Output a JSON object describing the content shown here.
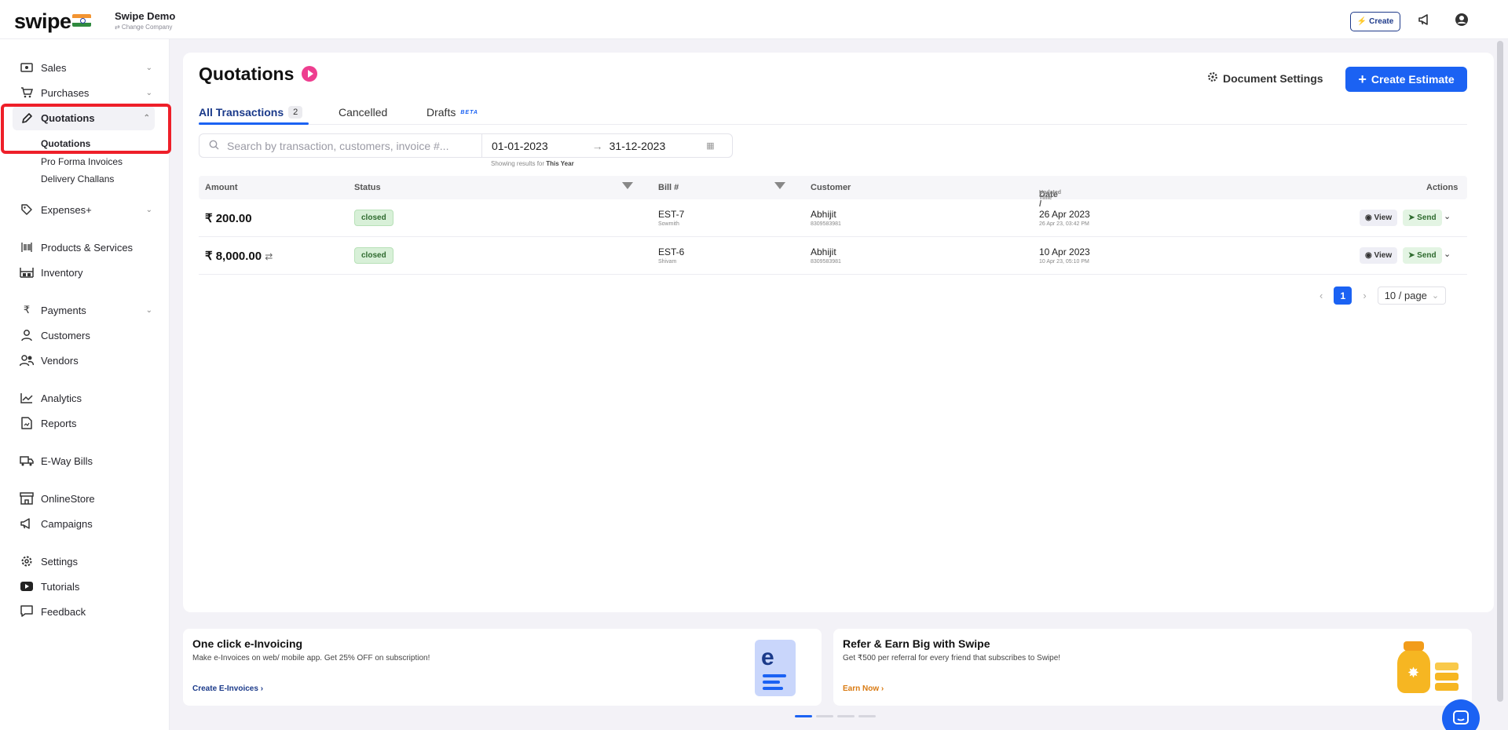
{
  "topbar": {
    "logo": "swipe",
    "company_name": "Swipe Demo",
    "change_company": "⇄ Change Company",
    "create_label": "Create"
  },
  "sidebar": {
    "items": [
      {
        "label": "Sales",
        "icon": "cash-icon",
        "has_chevron": true
      },
      {
        "label": "Purchases",
        "icon": "cart-icon",
        "has_chevron": true
      },
      {
        "label": "Quotations",
        "icon": "pencil-icon",
        "has_chevron": true,
        "active": true
      },
      {
        "label": "Expenses+",
        "icon": "tag-icon",
        "has_chevron": true
      },
      {
        "label": "Products & Services",
        "icon": "barcode-icon"
      },
      {
        "label": "Inventory",
        "icon": "warehouse-icon"
      },
      {
        "label": "Payments",
        "icon": "rupee-icon",
        "has_chevron": true
      },
      {
        "label": "Customers",
        "icon": "user-icon"
      },
      {
        "label": "Vendors",
        "icon": "users-icon"
      },
      {
        "label": "Analytics",
        "icon": "chart-line-icon"
      },
      {
        "label": "Reports",
        "icon": "file-icon"
      },
      {
        "label": "E-Way Bills",
        "icon": "truck-icon"
      },
      {
        "label": "OnlineStore",
        "icon": "store-icon"
      },
      {
        "label": "Campaigns",
        "icon": "megaphone-icon"
      },
      {
        "label": "Settings",
        "icon": "gear-icon"
      },
      {
        "label": "Tutorials",
        "icon": "youtube-icon"
      },
      {
        "label": "Feedback",
        "icon": "message-icon"
      }
    ],
    "subitems": [
      "Quotations",
      "Pro Forma Invoices",
      "Delivery Challans"
    ]
  },
  "main": {
    "title": "Quotations",
    "doc_settings": "Document Settings",
    "create_estimate": "Create Estimate",
    "tabs": [
      {
        "label": "All Transactions",
        "count": "2"
      },
      {
        "label": "Cancelled"
      },
      {
        "label": "Drafts",
        "badge": "BETA"
      }
    ],
    "search_placeholder": "Search by transaction, customers, invoice #...",
    "date_from": "01-01-2023",
    "date_to": "31-12-2023",
    "showing_prefix": "Showing results for",
    "showing_period": "This Year",
    "columns": {
      "amount": "Amount",
      "status": "Status",
      "bill": "Bill #",
      "customer": "Customer",
      "date": "Date /",
      "date_sub": "Updated Time",
      "actions": "Actions"
    },
    "rows": [
      {
        "amount": "₹ 200.00",
        "status": "closed",
        "bill": "EST-7",
        "bill_by": "Sowmith",
        "customer": "Abhijit",
        "phone": "8309583981",
        "date": "26 Apr 2023",
        "updated": "26 Apr 23, 03:42 PM",
        "recurring": false
      },
      {
        "amount": "₹ 8,000.00",
        "status": "closed",
        "bill": "EST-6",
        "bill_by": "Shivam",
        "customer": "Abhijit",
        "phone": "8309583981",
        "date": "10 Apr 2023",
        "updated": "10 Apr 23, 05:10 PM",
        "recurring": true
      }
    ],
    "view_label": "View",
    "send_label": "Send",
    "page": "1",
    "per_page": "10 / page"
  },
  "promos": [
    {
      "title": "One click e-Invoicing",
      "desc": "Make e-Invoices on web/ mobile app. Get 25% OFF on subscription!",
      "link": "Create E-Invoices",
      "link_color": "#1b3a8a"
    },
    {
      "title": "Refer & Earn Big with Swipe",
      "desc": "Get ₹500 per referral for every friend that subscribes to Swipe!",
      "link": "Earn Now",
      "link_color": "#d97a12"
    }
  ],
  "colors": {
    "accent": "#1b62f3",
    "highlight": "#ee1f29",
    "closed_badge": "#d8f0d8"
  }
}
